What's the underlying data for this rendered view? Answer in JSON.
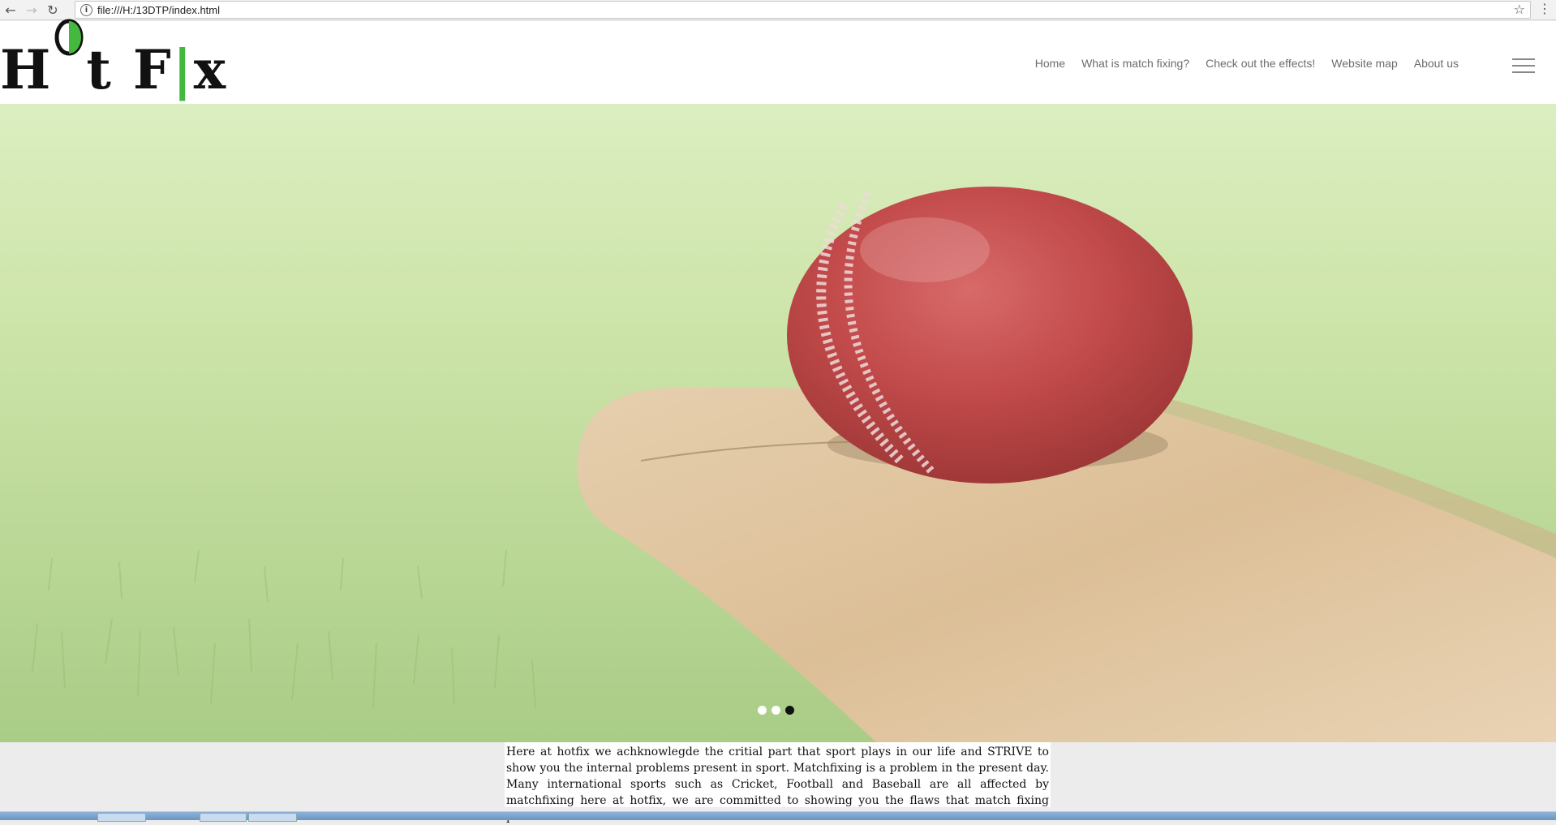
{
  "browser": {
    "back_icon": "arrow-left-icon",
    "forward_icon": "arrow-right-icon",
    "reload_icon": "reload-icon",
    "url": "file:///H:/13DTP/index.html"
  },
  "site": {
    "logo": {
      "part1": "H",
      "part2": "t F",
      "part3": "x"
    },
    "nav": [
      {
        "label": "Home"
      },
      {
        "label": "What is match fixing?"
      },
      {
        "label": "Check out the effects!"
      },
      {
        "label": "Website map"
      },
      {
        "label": "About us"
      }
    ]
  },
  "hero": {
    "image": "cricket-ball-on-bat",
    "slides": 3,
    "active_slide": 3
  },
  "intro": {
    "text": "Here at hotfix we achknowlegde the critial part that sport plays in our life and STRIVE to show you the internal problems present in sport. Matchfixing is a problem in the present day. Many international sports such as Cricket, Football and Baseball are all affected by matchfixing here at hotfix, we are committed to showing you the flaws that match fixing present."
  },
  "colors": {
    "accent_green": "#45b840",
    "nav_text": "#6d6d6d",
    "active_dot": "#111111"
  }
}
